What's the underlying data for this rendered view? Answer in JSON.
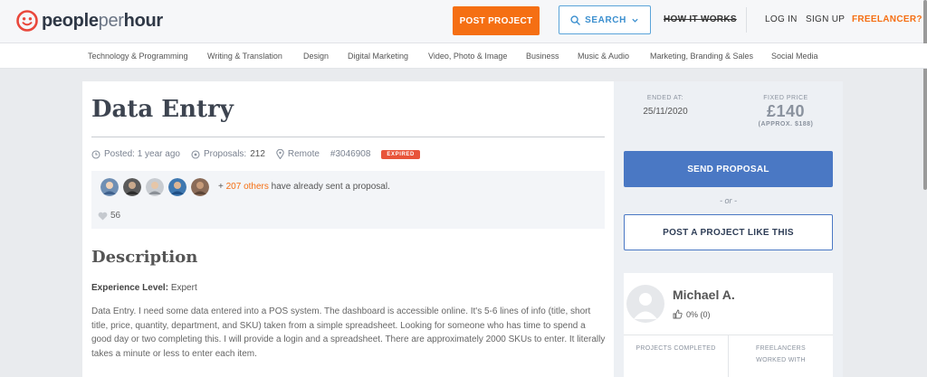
{
  "header": {
    "logo_bold": "people",
    "logo_light": "per",
    "logo_bold2": "hour",
    "post_project": "POST PROJECT",
    "search": "SEARCH",
    "how_it_works": "HOW IT WORKS",
    "login": "LOG IN",
    "signup": "SIGN UP",
    "freelancer": "FREELANCER?"
  },
  "categories": [
    "Technology & Programming",
    "Writing & Translation",
    "Design",
    "Digital Marketing",
    "Video, Photo & Image",
    "Business",
    "Music & Audio",
    "Marketing, Branding & Sales",
    "Social Media"
  ],
  "project": {
    "title": "Data Entry",
    "posted": "Posted: 1 year ago",
    "proposals_label": "Proposals:",
    "proposals_count": "212",
    "location": "Remote",
    "id": "#3046908",
    "status": "EXPIRED",
    "others_prefix": "+",
    "others_link": "207 others",
    "others_suffix": "have already sent a proposal.",
    "likes": "56",
    "description_title": "Description",
    "experience_label": "Experience Level:",
    "experience_value": "Expert",
    "description": "Data Entry. I need some data entered into a POS system. The dashboard is accessible online. It's 5-6 lines of info (title, short title, price, quantity, department, and SKU) taken from a simple spreadsheet. Looking for someone who has time to spend a good day or two completing this. I will provide a login and a spreadsheet. There are approximately 2000 SKUs to enter. It literally takes a minute or less to enter each item."
  },
  "sidebar": {
    "ended_label": "ENDED AT:",
    "ended_value": "25/11/2020",
    "price_label": "FIXED PRICE",
    "price_value": "£140",
    "price_approx": "(APPROX. $188)",
    "send_proposal": "SEND PROPOSAL",
    "or": "- or -",
    "post_like_this": "POST A PROJECT LIKE THIS",
    "buyer_name": "Michael A.",
    "buyer_rating": "0% (0)",
    "stat_projects": "PROJECTS COMPLETED",
    "stat_freelancers": "FREELANCERS WORKED WITH"
  },
  "colors": {
    "brand_orange": "#f56f13",
    "brand_blue": "#4a78c4",
    "expired_red": "#e8543a"
  }
}
